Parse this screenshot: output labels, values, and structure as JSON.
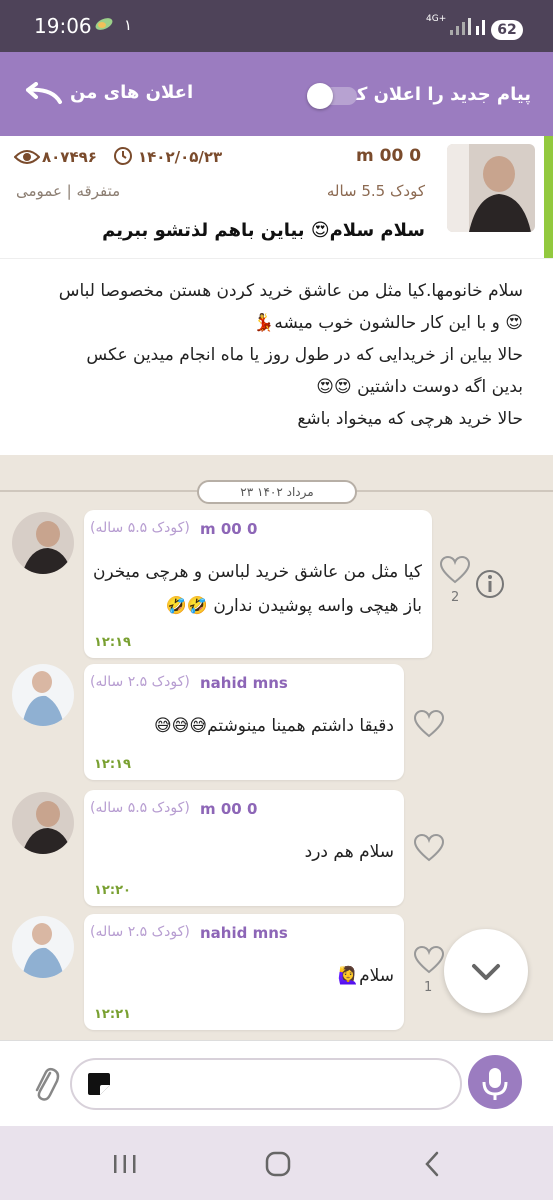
{
  "status_bar": {
    "time": "19:06",
    "notif_count": "۱",
    "network": "4G+",
    "battery": "62"
  },
  "header": {
    "post_label": "پیام جدید را اعلان کن",
    "my_ads": "اعلان های من",
    "toggle_on": false
  },
  "post": {
    "author": "m 00 0",
    "age": "کودک 5.5 ساله",
    "date": "۱۴۰۲/۰۵/۲۳",
    "views": "۸۰۷۴۹۶",
    "category": "متفرقه | عمومی",
    "title": "سلام سلام😍 بیاین باهم لذتشو ببریم",
    "body": [
      "سلام خانومها.کیا مثل من عاشق خرید کردن هستن مخصوصا لباس",
      "😍 و با این کار حالشون خوب میشه💃",
      "حالا بیاین از خریدایی که در طول روز یا ماه انجام میدین عکس",
      "بدین اگه دوست داشتین 😍😍",
      "حالا خرید هرچی که میخواد باشع"
    ]
  },
  "chat": {
    "date_pill": "۲۳ مرداد ۱۴۰۲",
    "messages": [
      {
        "name": "m 00 0",
        "age": "(کودک ۵.۵ ساله)",
        "lines": [
          "کیا مثل من عاشق خرید لباسن و هرچی میخرن",
          "باز هیچی واسه پوشیدن ندارن 🤣🤣"
        ],
        "time": "۱۲:۱۹",
        "likes": "2"
      },
      {
        "name": "nahid mns",
        "age": "(کودک ۲.۵ ساله)",
        "lines": [
          "دقیقا داشتم همینا مینوشتم😅😅😅"
        ],
        "time": "۱۲:۱۹",
        "likes": ""
      },
      {
        "name": "m 00 0",
        "age": "(کودک ۵.۵ ساله)",
        "lines": [
          "سلام هم درد"
        ],
        "time": "۱۲:۲۰",
        "likes": ""
      },
      {
        "name": "nahid mns",
        "age": "(کودک ۲.۵ ساله)",
        "lines": [
          "سلام🙋‍♀️"
        ],
        "time": "۱۲:۲۱",
        "likes": "1"
      }
    ]
  },
  "composer": {
    "placeholder": ""
  }
}
